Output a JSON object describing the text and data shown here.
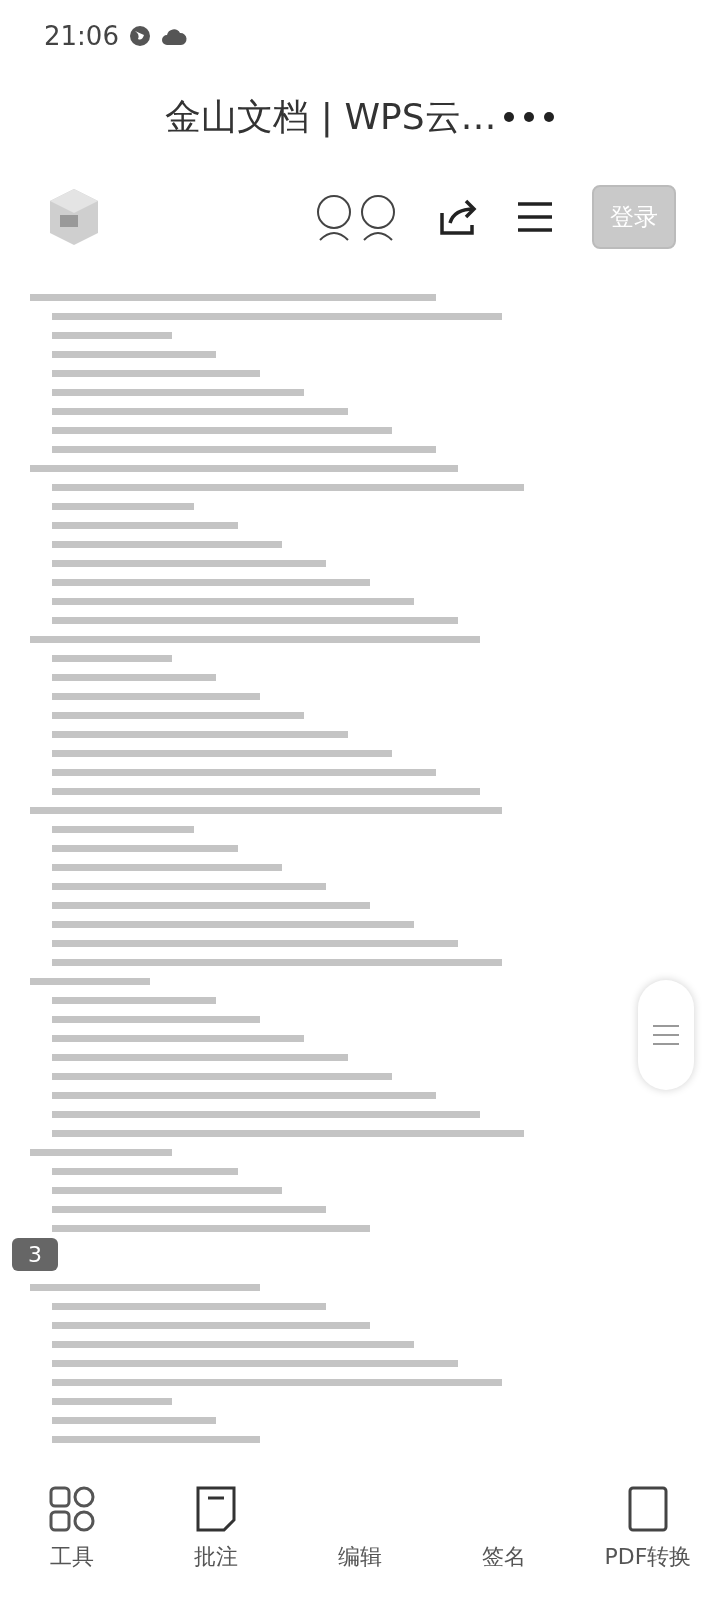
{
  "status_bar": {
    "time": "21:06"
  },
  "window": {
    "title": "金山文档 | WPS云…"
  },
  "toolbar": {
    "login_button": "登录"
  },
  "document": {
    "page_badge": "3"
  },
  "bottom_nav": [
    {
      "label": "工具",
      "kind": "tools"
    },
    {
      "label": "批注",
      "kind": "note"
    },
    {
      "label": "编辑",
      "kind": "edit"
    },
    {
      "label": "签名",
      "kind": "sign"
    },
    {
      "label": "PDF转换",
      "kind": "pdf"
    }
  ]
}
